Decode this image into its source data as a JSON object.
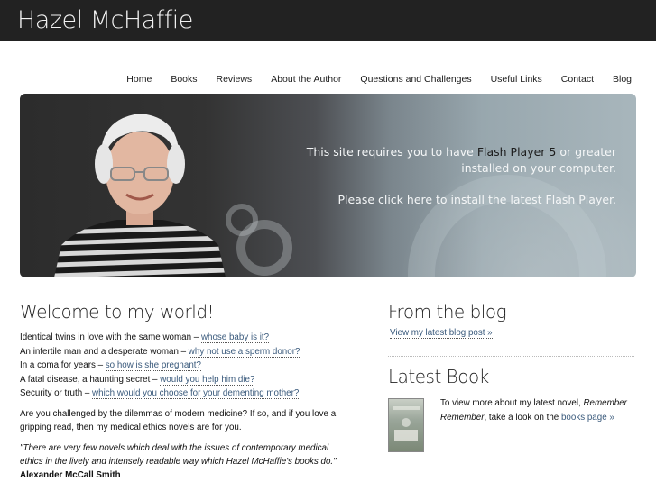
{
  "site": {
    "title": "Hazel McHaffie"
  },
  "nav": [
    {
      "label": "Home"
    },
    {
      "label": "Books"
    },
    {
      "label": "Reviews"
    },
    {
      "label": "About the Author"
    },
    {
      "label": "Questions and Challenges"
    },
    {
      "label": "Useful Links"
    },
    {
      "label": "Contact"
    },
    {
      "label": "Blog"
    }
  ],
  "hero": {
    "line1_pre": "This site requires you to have ",
    "line1_hl": "Flash Player 5",
    "line1_post": " or greater",
    "line2": "installed on your computer.",
    "line3": "Please click here to install the latest Flash Player."
  },
  "welcome": {
    "heading": "Welcome to my world!",
    "teasers": [
      {
        "text": "Identical twins in love with the same woman – ",
        "link": "whose baby is it?"
      },
      {
        "text": "An infertile man and a desperate woman – ",
        "link": "why not use a sperm donor?"
      },
      {
        "text": "In a coma for years – ",
        "link": "so how is she pregnant?"
      },
      {
        "text": "A fatal disease, a haunting secret – ",
        "link": "would you help him die?"
      },
      {
        "text": "Security or truth – ",
        "link": "which would you choose for your dementing mother?"
      }
    ],
    "para": "Are you challenged by the dilemmas of modern medicine? If so, and if you love a gripping read, then my medical ethics novels are for you.",
    "quote": "\"There are very few novels which deal with the issues of contemporary medical ethics in the lively and intensely readable way which Hazel McHaffie's books do.\"",
    "quote_author": "Alexander McCall Smith"
  },
  "blog": {
    "heading": "From the blog",
    "link": "View my latest blog post »"
  },
  "latest_book": {
    "heading": "Latest Book",
    "text_pre": "To view more about my latest novel, ",
    "title": "Remember Remember",
    "text_mid": ", take a look on the ",
    "link": "books page »"
  }
}
